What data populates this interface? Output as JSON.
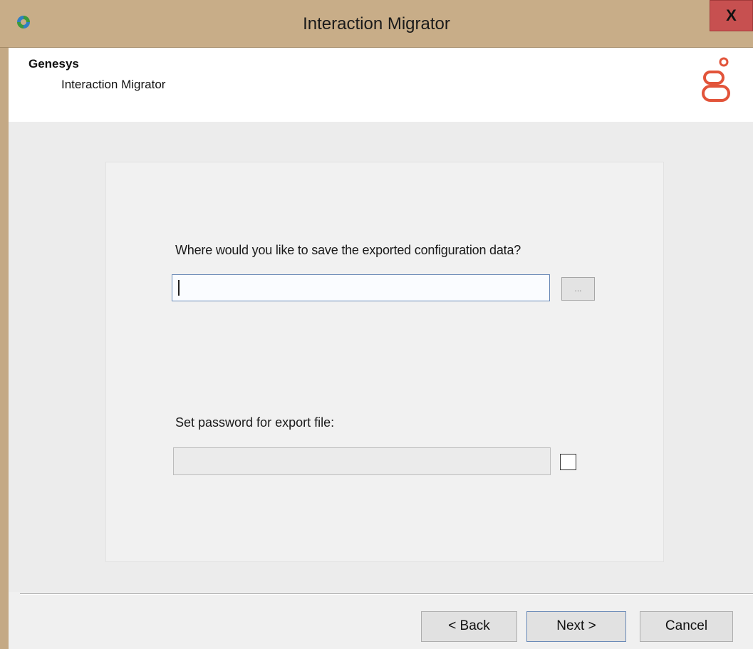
{
  "window": {
    "title": "Interaction Migrator",
    "close_label": "X"
  },
  "header": {
    "company": "Genesys",
    "product": "Interaction Migrator",
    "logo_icon": "genesys-logo-icon",
    "logo_color": "#e2543a"
  },
  "export": {
    "path_question": "Where would you like to save the exported configuration data?",
    "path_value": "",
    "browse_label": "...",
    "password_label": "Set password for export file:",
    "password_value": "",
    "password_checkbox_checked": false
  },
  "footer": {
    "back_label": "< Back",
    "next_label": "Next >",
    "cancel_label": "Cancel"
  },
  "colors": {
    "titlebar": "#c8ad88",
    "close_button": "#c75050",
    "focus_border": "#6a8ab7"
  }
}
